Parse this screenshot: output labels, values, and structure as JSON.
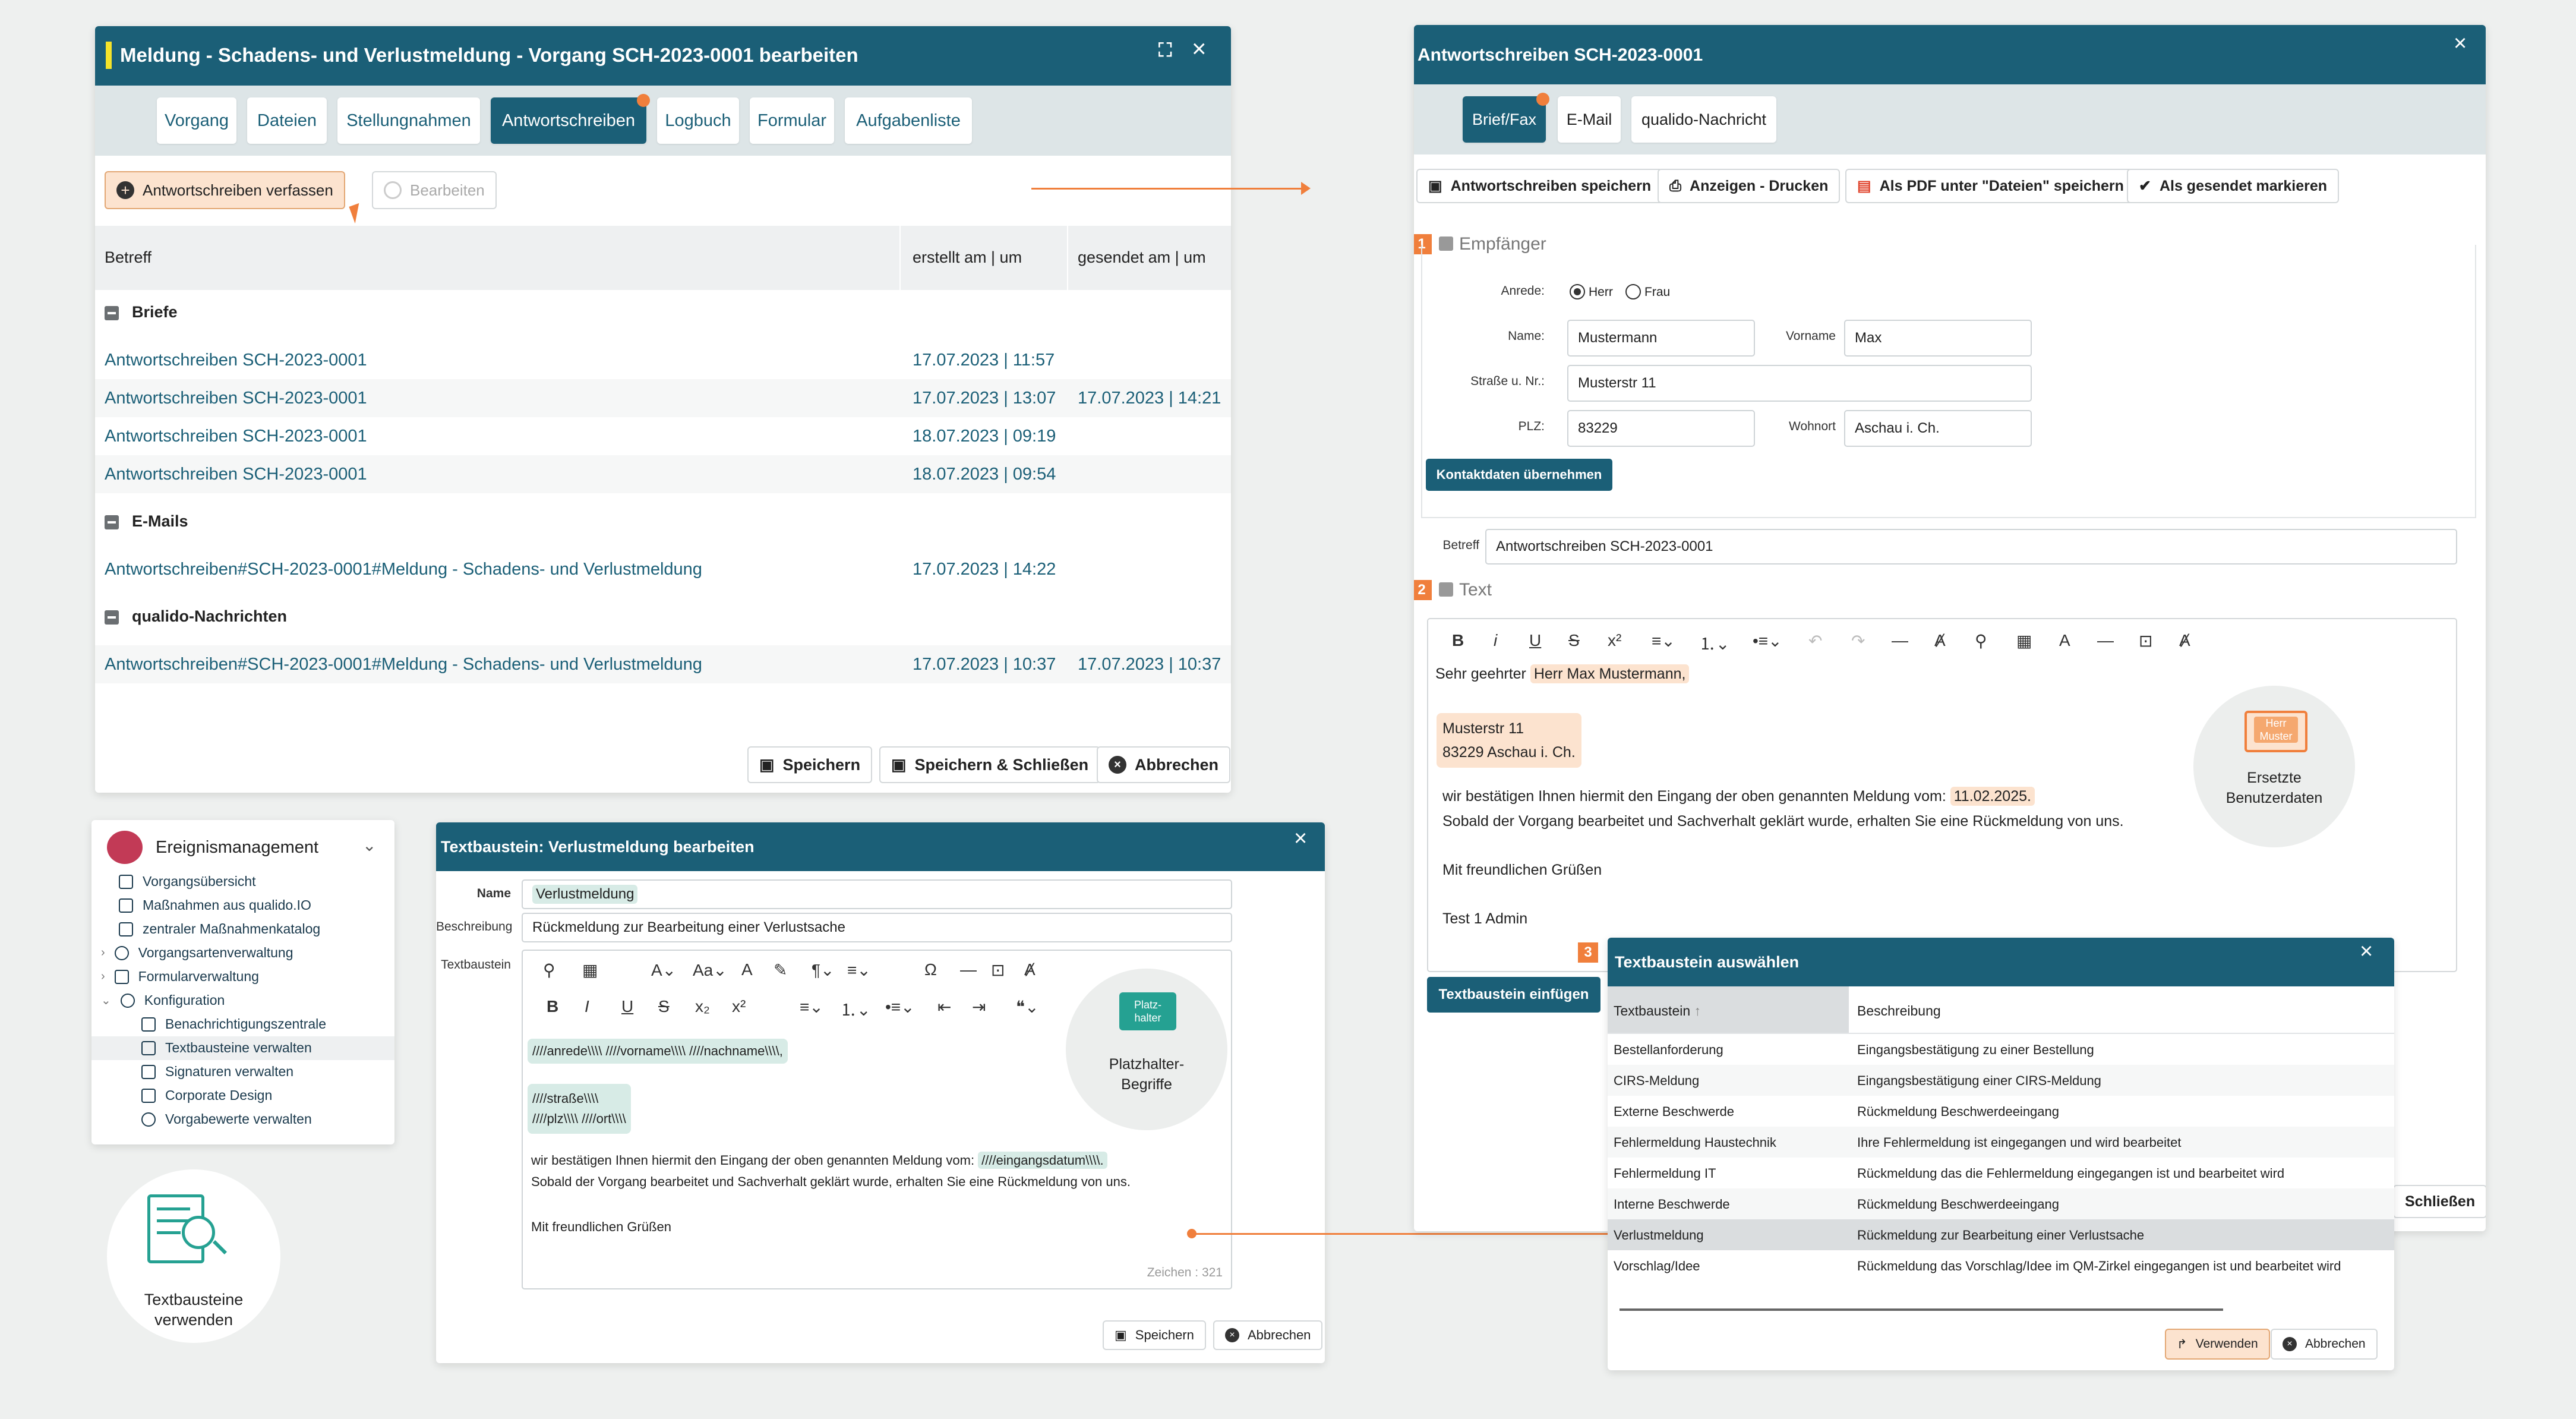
{
  "colors": {
    "primary": "#1b5f77",
    "accent": "#f07f3c",
    "highlight": "#fce3cf",
    "teal_highlight": "#d7ebe6"
  },
  "main_window": {
    "title": "Meldung - Schadens- und Verlustmeldung - Vorgang SCH-2023-0001 bearbeiten",
    "tabs": [
      "Vorgang",
      "Dateien",
      "Stellungnahmen",
      "Antwortschreiben",
      "Logbuch",
      "Formular",
      "Aufgabenliste"
    ],
    "compose_label": "Antwortschreiben verfassen",
    "edit_label": "Bearbeiten",
    "columns": {
      "betreff": "Betreff",
      "erstellt": "erstellt am | um",
      "gesendet": "gesendet am | um"
    },
    "groups": {
      "briefe": {
        "title": "Briefe",
        "rows": [
          {
            "betreff": "Antwortschreiben SCH-2023-0001",
            "erstellt": "17.07.2023 | 11:57",
            "gesendet": ""
          },
          {
            "betreff": "Antwortschreiben SCH-2023-0001",
            "erstellt": "17.07.2023 | 13:07",
            "gesendet": "17.07.2023 | 14:21"
          },
          {
            "betreff": "Antwortschreiben SCH-2023-0001",
            "erstellt": "18.07.2023 | 09:19",
            "gesendet": ""
          },
          {
            "betreff": "Antwortschreiben SCH-2023-0001",
            "erstellt": "18.07.2023 | 09:54",
            "gesendet": ""
          }
        ]
      },
      "emails": {
        "title": "E-Mails",
        "rows": [
          {
            "betreff": "Antwortschreiben#SCH-2023-0001#Meldung - Schadens- und Verlustmeldung",
            "erstellt": "17.07.2023 | 14:22",
            "gesendet": ""
          }
        ]
      },
      "qualido": {
        "title": "qualido-Nachrichten",
        "rows": [
          {
            "betreff": "Antwortschreiben#SCH-2023-0001#Meldung - Schadens- und Verlustmeldung",
            "erstellt": "17.07.2023 | 10:37",
            "gesendet": "17.07.2023 | 10:37"
          }
        ]
      }
    },
    "footer": {
      "save": "Speichern",
      "save_close": "Speichern & Schließen",
      "cancel": "Abbrechen"
    }
  },
  "sidebar": {
    "title": "Ereignismanagement",
    "items": [
      "Vorgangsübersicht",
      "Maßnahmen aus qualido.IO",
      "zentraler Maßnahmenkatalog",
      "Vorgangsartenverwaltung",
      "Formularverwaltung",
      "Konfiguration"
    ],
    "subitems": [
      "Benachrichtigungszentrale",
      "Textbausteine verwalten",
      "Signaturen verwalten",
      "Corporate Design",
      "Vorgabewerte verwalten"
    ]
  },
  "feature_badge": {
    "line1": "Textbausteine",
    "line2": "verwenden"
  },
  "editor_dialog": {
    "title": "Textbaustein: Verlustmeldung bearbeiten",
    "name_label": "Name",
    "name_value": "Verlustmeldung",
    "desc_label": "Beschreibung",
    "desc_value": "Rückmeldung zur Bearbeitung einer Verlustsache",
    "body_label": "Textbaustein",
    "line1": "////anrede\\\\\\\\ ////vorname\\\\\\\\ ////nachname\\\\\\\\,",
    "line2": "////straße\\\\\\\\",
    "line3": "////plz\\\\\\\\ ////ort\\\\\\\\",
    "line4_pre": "wir bestätigen Ihnen hiermit den Eingang der oben genannten Meldung vom: ",
    "line4_var": "////eingangsdatum\\\\\\\\.",
    "line5": "Sobald der Vorgang bearbeitet und Sachverhalt geklärt wurde, erhalten Sie eine Rückmeldung von uns.",
    "line6": "Mit freundlichen Grüßen",
    "counter": "Zeichen : 321",
    "placeholder_icon_text": "Platz-\nhalter",
    "placeholder_caption": "Platzhalter-\nBegriffe",
    "save": "Speichern",
    "cancel": "Abbrechen"
  },
  "letter_window": {
    "title": "Antwortschreiben SCH-2023-0001",
    "tabs": [
      "Brief/Fax",
      "E-Mail",
      "qualido-Nachricht"
    ],
    "actions": [
      "Antwortschreiben speichern",
      "Anzeigen - Drucken",
      "Als PDF unter \"Dateien\" speichern",
      "Als gesendet markieren"
    ],
    "section1_num": "1",
    "section1": "Empfänger",
    "anrede_label": "Anrede:",
    "anrede_opts": [
      "Herr",
      "Frau"
    ],
    "name_label": "Name:",
    "name_value": "Mustermann",
    "vorname_label": "Vorname",
    "vorname_value": "Max",
    "strasse_label": "Straße u. Nr.:",
    "strasse_value": "Musterstr 11",
    "plz_label": "PLZ:",
    "plz_value": "83229",
    "wohnort_label": "Wohnort",
    "wohnort_value": "Aschau i. Ch.",
    "contact_btn": "Kontaktdaten übernehmen",
    "betreff_label": "Betreff",
    "betreff_value": "Antwortschreiben SCH-2023-0001",
    "section2_num": "2",
    "section2": "Text",
    "text_greeting": "Sehr geehrter ",
    "text_name": "Herr Max Mustermann,",
    "text_addr1": "Musterstr 11",
    "text_addr2": "83229 Aschau i. Ch.",
    "text_body_pre": "wir bestätigen Ihnen hiermit den Eingang der oben genannten Meldung vom: ",
    "text_date": "11.02.2025.",
    "text_body2": "Sobald der Vorgang bearbeitet und Sachverhalt geklärt wurde, erhalten Sie eine Rückmeldung von uns.",
    "text_closing": "Mit freundlichen Grüßen",
    "text_sig": "Test 1 Admin",
    "replaced_icon_text": "Herr\nMuster",
    "replaced_caption": "Ersetzte\nBenutzerdaten",
    "insert_btn": "Textbaustein einfügen",
    "close_btn": "Schließen"
  },
  "select_dialog": {
    "num": "3",
    "title": "Textbaustein auswählen",
    "col1": "Textbaustein",
    "col2": "Beschreibung",
    "rows": [
      {
        "name": "Bestellanforderung",
        "desc": "Eingangsbestätigung zu einer Bestellung"
      },
      {
        "name": "CIRS-Meldung",
        "desc": "Eingangsbestätigung einer CIRS-Meldung"
      },
      {
        "name": "Externe Beschwerde",
        "desc": "Rückmeldung Beschwerdeeingang"
      },
      {
        "name": "Fehlermeldung Haustechnik",
        "desc": "Ihre Fehlermeldung ist eingegangen und wird bearbeitet"
      },
      {
        "name": "Fehlermeldung IT",
        "desc": "Rückmeldung das die Fehlermeldung eingegangen ist und bearbeitet wird"
      },
      {
        "name": "Interne Beschwerde",
        "desc": "Rückmeldung Beschwerdeeingang"
      },
      {
        "name": "Verlustmeldung",
        "desc": "Rückmeldung zur Bearbeitung einer Verlustsache"
      },
      {
        "name": "Vorschlag/Idee",
        "desc": "Rückmeldung das Vorschlag/Idee im QM-Zirkel eingegangen ist und bearbeitet wird"
      }
    ],
    "use": "Verwenden",
    "cancel": "Abbrechen"
  }
}
